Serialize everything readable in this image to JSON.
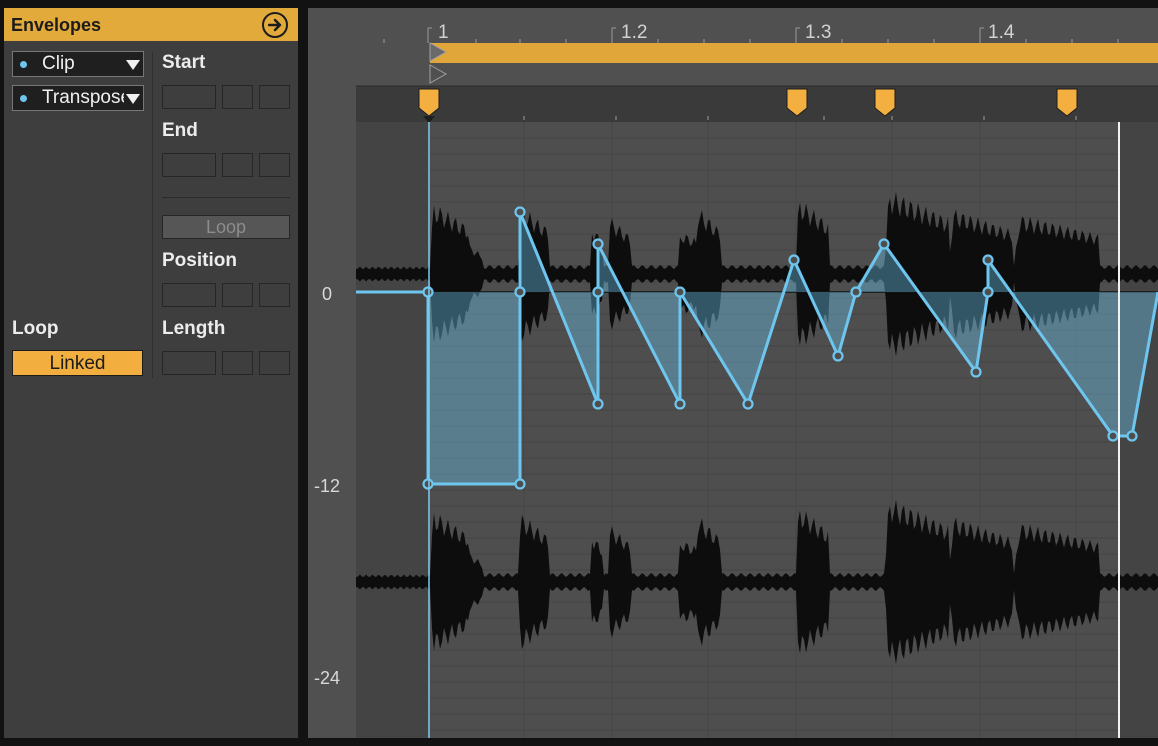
{
  "panel": {
    "title": "Envelopes",
    "device_dropdown": "Clip",
    "control_dropdown": "Transpose",
    "start_label": "Start",
    "end_label": "End",
    "loop_button": "Loop",
    "position_label": "Position",
    "length_label": "Length",
    "loop_label": "Loop",
    "linked_button": "Linked"
  },
  "ruler": {
    "bars": [
      "1",
      "1.2",
      "1.3",
      "1.4"
    ]
  },
  "axis": {
    "labels": [
      "0",
      "-12",
      "-24"
    ]
  },
  "colors": {
    "accent": "#e2a93b",
    "envelope": "#6ec6ef",
    "panel": "#3e3e3e",
    "waveform": "#0d0d0d"
  },
  "icons": {
    "go": "arrow-right-circle-icon",
    "device_dot": "dot-icon",
    "dropdown": "triangle-down-icon"
  }
}
